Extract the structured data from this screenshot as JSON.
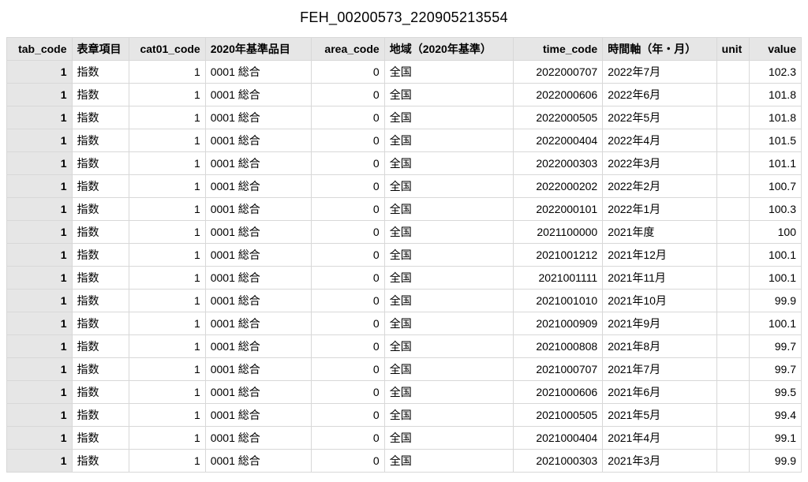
{
  "title": "FEH_00200573_220905213554",
  "columns": [
    "tab_code",
    "表章項目",
    "cat01_code",
    "2020年基準品目",
    "area_code",
    "地域（2020年基準）",
    "time_code",
    "時間軸（年・月）",
    "unit",
    "value"
  ],
  "rows": [
    {
      "tab_code": "1",
      "hyo": "指数",
      "cat01": "1",
      "item": "0001 総合",
      "area": "0",
      "chiiki": "全国",
      "time": "2022000707",
      "jikan": "2022年7月",
      "unit": "",
      "value": "102.3"
    },
    {
      "tab_code": "1",
      "hyo": "指数",
      "cat01": "1",
      "item": "0001 総合",
      "area": "0",
      "chiiki": "全国",
      "time": "2022000606",
      "jikan": "2022年6月",
      "unit": "",
      "value": "101.8"
    },
    {
      "tab_code": "1",
      "hyo": "指数",
      "cat01": "1",
      "item": "0001 総合",
      "area": "0",
      "chiiki": "全国",
      "time": "2022000505",
      "jikan": "2022年5月",
      "unit": "",
      "value": "101.8"
    },
    {
      "tab_code": "1",
      "hyo": "指数",
      "cat01": "1",
      "item": "0001 総合",
      "area": "0",
      "chiiki": "全国",
      "time": "2022000404",
      "jikan": "2022年4月",
      "unit": "",
      "value": "101.5"
    },
    {
      "tab_code": "1",
      "hyo": "指数",
      "cat01": "1",
      "item": "0001 総合",
      "area": "0",
      "chiiki": "全国",
      "time": "2022000303",
      "jikan": "2022年3月",
      "unit": "",
      "value": "101.1"
    },
    {
      "tab_code": "1",
      "hyo": "指数",
      "cat01": "1",
      "item": "0001 総合",
      "area": "0",
      "chiiki": "全国",
      "time": "2022000202",
      "jikan": "2022年2月",
      "unit": "",
      "value": "100.7"
    },
    {
      "tab_code": "1",
      "hyo": "指数",
      "cat01": "1",
      "item": "0001 総合",
      "area": "0",
      "chiiki": "全国",
      "time": "2022000101",
      "jikan": "2022年1月",
      "unit": "",
      "value": "100.3"
    },
    {
      "tab_code": "1",
      "hyo": "指数",
      "cat01": "1",
      "item": "0001 総合",
      "area": "0",
      "chiiki": "全国",
      "time": "2021100000",
      "jikan": "2021年度",
      "unit": "",
      "value": "100"
    },
    {
      "tab_code": "1",
      "hyo": "指数",
      "cat01": "1",
      "item": "0001 総合",
      "area": "0",
      "chiiki": "全国",
      "time": "2021001212",
      "jikan": "2021年12月",
      "unit": "",
      "value": "100.1"
    },
    {
      "tab_code": "1",
      "hyo": "指数",
      "cat01": "1",
      "item": "0001 総合",
      "area": "0",
      "chiiki": "全国",
      "time": "2021001111",
      "jikan": "2021年11月",
      "unit": "",
      "value": "100.1"
    },
    {
      "tab_code": "1",
      "hyo": "指数",
      "cat01": "1",
      "item": "0001 総合",
      "area": "0",
      "chiiki": "全国",
      "time": "2021001010",
      "jikan": "2021年10月",
      "unit": "",
      "value": "99.9"
    },
    {
      "tab_code": "1",
      "hyo": "指数",
      "cat01": "1",
      "item": "0001 総合",
      "area": "0",
      "chiiki": "全国",
      "time": "2021000909",
      "jikan": "2021年9月",
      "unit": "",
      "value": "100.1"
    },
    {
      "tab_code": "1",
      "hyo": "指数",
      "cat01": "1",
      "item": "0001 総合",
      "area": "0",
      "chiiki": "全国",
      "time": "2021000808",
      "jikan": "2021年8月",
      "unit": "",
      "value": "99.7"
    },
    {
      "tab_code": "1",
      "hyo": "指数",
      "cat01": "1",
      "item": "0001 総合",
      "area": "0",
      "chiiki": "全国",
      "time": "2021000707",
      "jikan": "2021年7月",
      "unit": "",
      "value": "99.7"
    },
    {
      "tab_code": "1",
      "hyo": "指数",
      "cat01": "1",
      "item": "0001 総合",
      "area": "0",
      "chiiki": "全国",
      "time": "2021000606",
      "jikan": "2021年6月",
      "unit": "",
      "value": "99.5"
    },
    {
      "tab_code": "1",
      "hyo": "指数",
      "cat01": "1",
      "item": "0001 総合",
      "area": "0",
      "chiiki": "全国",
      "time": "2021000505",
      "jikan": "2021年5月",
      "unit": "",
      "value": "99.4"
    },
    {
      "tab_code": "1",
      "hyo": "指数",
      "cat01": "1",
      "item": "0001 総合",
      "area": "0",
      "chiiki": "全国",
      "time": "2021000404",
      "jikan": "2021年4月",
      "unit": "",
      "value": "99.1"
    },
    {
      "tab_code": "1",
      "hyo": "指数",
      "cat01": "1",
      "item": "0001 総合",
      "area": "0",
      "chiiki": "全国",
      "time": "2021000303",
      "jikan": "2021年3月",
      "unit": "",
      "value": "99.9"
    }
  ],
  "chart_data": {
    "type": "table",
    "title": "FEH_00200573_220905213554",
    "columns": [
      "tab_code",
      "表章項目",
      "cat01_code",
      "2020年基準品目",
      "area_code",
      "地域（2020年基準）",
      "time_code",
      "時間軸（年・月）",
      "unit",
      "value"
    ],
    "time_label": [
      "2022年7月",
      "2022年6月",
      "2022年5月",
      "2022年4月",
      "2022年3月",
      "2022年2月",
      "2022年1月",
      "2021年度",
      "2021年12月",
      "2021年11月",
      "2021年10月",
      "2021年9月",
      "2021年8月",
      "2021年7月",
      "2021年6月",
      "2021年5月",
      "2021年4月",
      "2021年3月"
    ],
    "value": [
      102.3,
      101.8,
      101.8,
      101.5,
      101.1,
      100.7,
      100.3,
      100,
      100.1,
      100.1,
      99.9,
      100.1,
      99.7,
      99.7,
      99.5,
      99.4,
      99.1,
      99.9
    ]
  }
}
